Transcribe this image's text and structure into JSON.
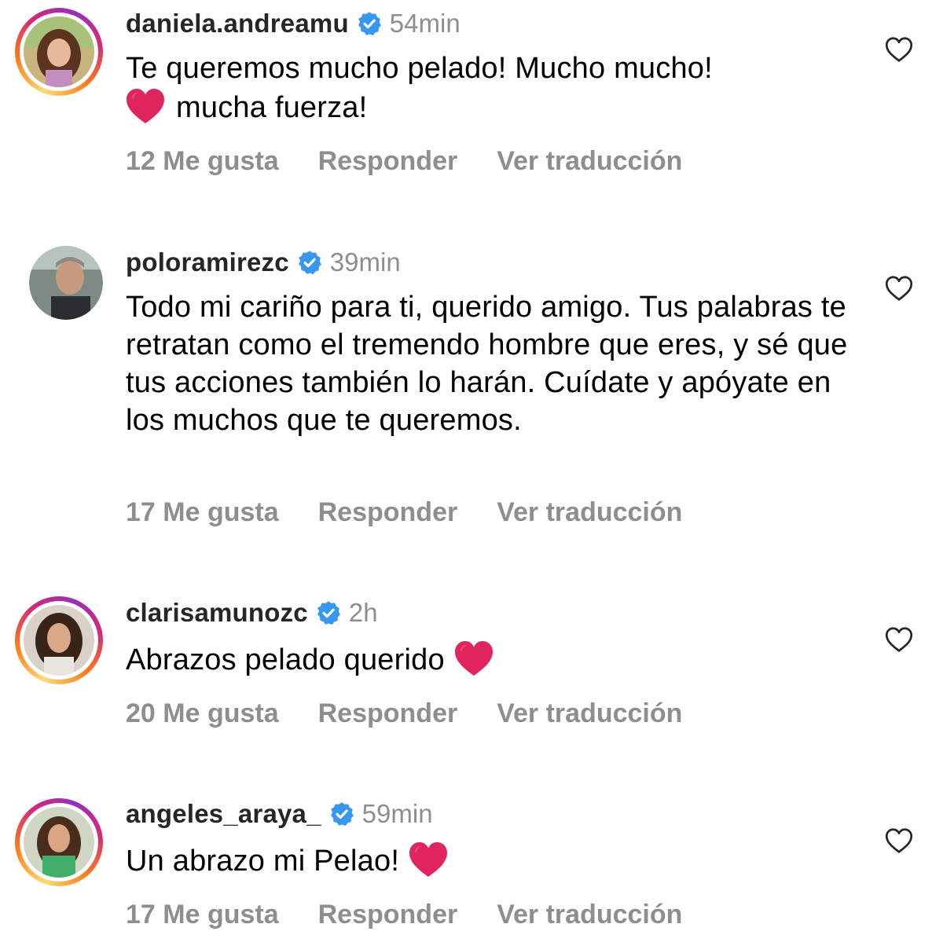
{
  "comments": [
    {
      "username": "daniela.andreamu",
      "time": "54min",
      "text_line1": "Te queremos mucho pelado! Mucho mucho!",
      "text_line2": "mucha fuerza!",
      "likes": "12 Me gusta",
      "reply": "Responder",
      "translate": "Ver traducción",
      "story_ring": true
    },
    {
      "username": "poloramirezc",
      "time": "39min",
      "text": "Todo mi cariño para ti, querido amigo. Tus palabras te retratan como el tremendo hombre que eres, y sé que tus acciones también lo harán. Cuídate y apóyate en los muchos que te queremos.",
      "likes": "17 Me gusta",
      "reply": "Responder",
      "translate": "Ver traducción",
      "story_ring": false
    },
    {
      "username": "clarisamunozc",
      "time": "2h",
      "text": "Abrazos pelado querido",
      "likes": "20 Me gusta",
      "reply": "Responder",
      "translate": "Ver traducción",
      "story_ring": true
    },
    {
      "username": "angeles_araya_",
      "time": "59min",
      "text": "Un abrazo mi Pelao!",
      "likes": "17 Me gusta",
      "reply": "Responder",
      "translate": "Ver traducción",
      "story_ring": true
    }
  ],
  "icons": {
    "verified": "verified-badge-icon",
    "like": "heart-outline-icon",
    "emoji": "red-heart-emoji"
  },
  "colors": {
    "verified_blue": "#3897f0",
    "muted": "#8e8e8e",
    "emoji_red": "#e0245e"
  }
}
